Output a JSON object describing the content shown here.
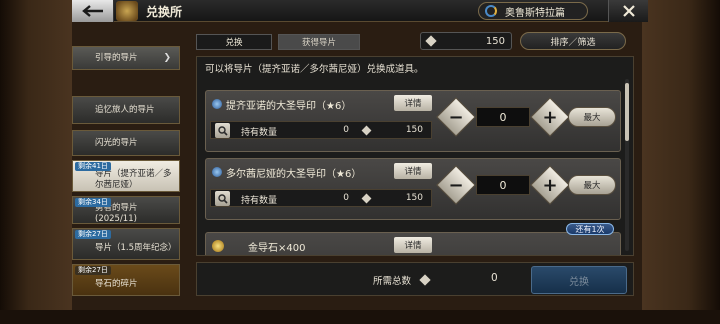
{
  "header": {
    "title": "兑换所",
    "story_label": "奥鲁斯特拉篇"
  },
  "tabs": [
    {
      "label": "兑换"
    },
    {
      "label": "获得导片"
    }
  ],
  "currency": {
    "amount": "150"
  },
  "sort_filter_label": "排序／筛选",
  "sidebar": {
    "items": [
      {
        "label": "引导的导片",
        "tag": ""
      },
      {
        "label": "追忆旅人的导片",
        "tag": ""
      },
      {
        "label": "闪光的导片",
        "tag": ""
      },
      {
        "label": "导片（提齐亚诺／多尔茜尼娅）",
        "tag": "剩余41日"
      },
      {
        "label": "勇者的导片(2025/11)",
        "tag": "剩余34日"
      },
      {
        "label": "导片（1.5周年纪念）",
        "tag": "剩余27日"
      },
      {
        "label": "导石的碎片",
        "tag": "剩余27日"
      }
    ]
  },
  "panel": {
    "description": "可以将导片（提齐亚诺／多尔茜尼娅）兑换成道具。",
    "detail_label": "详情",
    "stock_label": "持有数量",
    "max_label": "最大",
    "cards": [
      {
        "name": "提齐亚诺的大圣导印（★6）",
        "stock": "0",
        "price": "150",
        "qty": "0"
      },
      {
        "name": "多尔茜尼娅的大圣导印（★6）",
        "stock": "0",
        "price": "150",
        "qty": "0"
      },
      {
        "name": "金导石×400",
        "stock": "",
        "price": "",
        "qty": ""
      }
    ],
    "remain_badge": "还有1次"
  },
  "footer": {
    "total_label": "所需总数",
    "total_value": "0",
    "exchange_label": "兑换"
  },
  "colors": {
    "accent_blue": "#2d6ba0",
    "panel_bg": "#1c1c1b",
    "card_bg": "#403e3c"
  }
}
